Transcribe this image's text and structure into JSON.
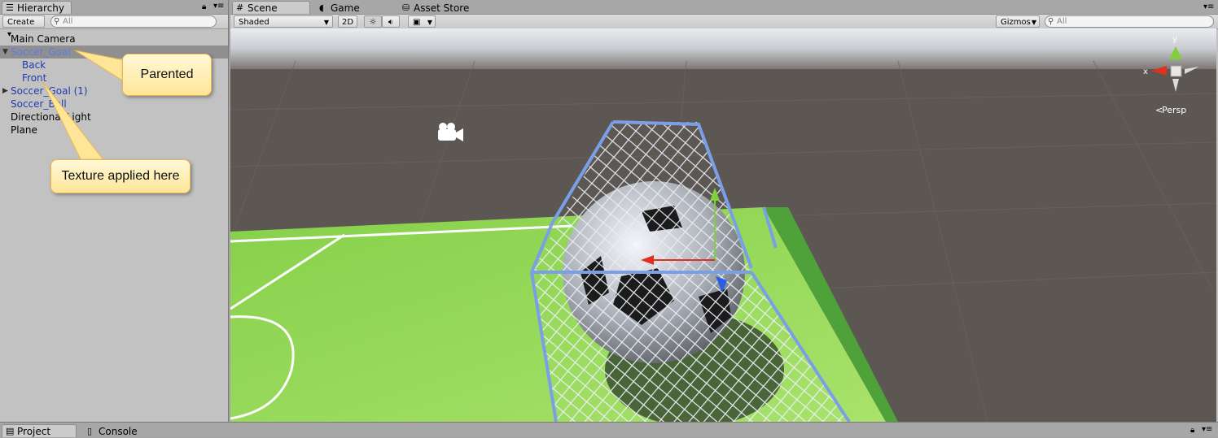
{
  "hierarchy": {
    "tab_label": "Hierarchy",
    "create_label": "Create ▾",
    "search_placeholder": "All",
    "items": [
      {
        "label": "Main Camera"
      },
      {
        "label": "Soccer_Goal"
      },
      {
        "label": "Back"
      },
      {
        "label": "Front"
      },
      {
        "label": "Soccer_Goal (1)"
      },
      {
        "label": "Soccer_Ball"
      },
      {
        "label": "Directional Light"
      },
      {
        "label": "Plane"
      }
    ]
  },
  "scene": {
    "tabs": [
      {
        "label": "Scene"
      },
      {
        "label": "Game"
      },
      {
        "label": "Asset Store"
      }
    ],
    "shading_mode": "Shaded",
    "mode_2d_label": "2D",
    "gizmos_label": "Gizmos",
    "search_placeholder": "All",
    "axis_y": "y",
    "axis_x": "x",
    "projection_label": "Persp"
  },
  "callouts": {
    "parented": "Parented",
    "texture": "Texture applied here"
  },
  "bottom": {
    "tabs": [
      {
        "label": "Project"
      },
      {
        "label": "Console"
      }
    ]
  },
  "colors": {
    "panel_bg": "#c2c2c2",
    "ground": "#5d5754",
    "field": "#8fd453",
    "goal_frame": "#7a9fe6",
    "callout_fill": "#ffe598"
  }
}
